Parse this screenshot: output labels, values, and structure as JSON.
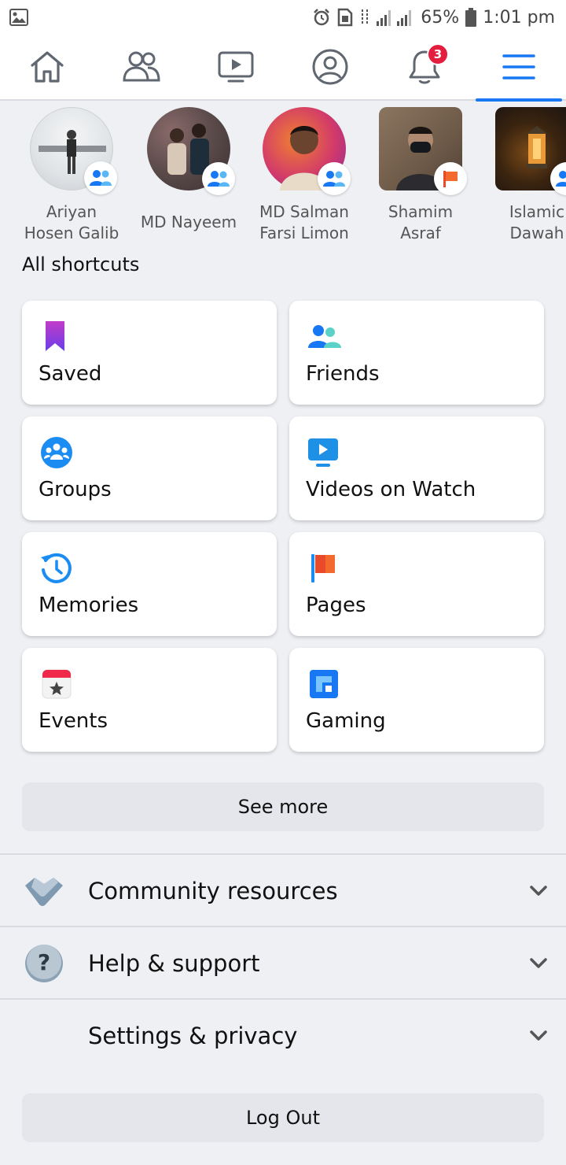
{
  "status_bar": {
    "battery": "65%",
    "time": "1:01 pm"
  },
  "nav": {
    "tabs": [
      {
        "name": "home",
        "icon": "home-icon"
      },
      {
        "name": "friends",
        "icon": "friends-icon"
      },
      {
        "name": "watch",
        "icon": "video-icon"
      },
      {
        "name": "profile",
        "icon": "profile-icon"
      },
      {
        "name": "notifications",
        "icon": "bell-icon",
        "badge": "3"
      },
      {
        "name": "menu",
        "icon": "hamburger-icon",
        "active": true
      }
    ]
  },
  "profiles": [
    {
      "name_line1": "Ariyan",
      "name_line2": "Hosen Galib",
      "badge": "group-icon"
    },
    {
      "name_line1": "MD Nayeem",
      "name_line2": "",
      "badge": "group-icon"
    },
    {
      "name_line1": "MD Salman",
      "name_line2": "Farsi Limon",
      "badge": "group-icon"
    },
    {
      "name_line1": "Shamim",
      "name_line2": "Asraf",
      "badge": "flag-icon"
    },
    {
      "name_line1": "Islamic",
      "name_line2": "Dawah",
      "badge": "group-icon"
    }
  ],
  "shortcuts_title": "All shortcuts",
  "shortcuts": [
    {
      "label": "Saved",
      "icon": "bookmark-icon"
    },
    {
      "label": "Friends",
      "icon": "friends-icon"
    },
    {
      "label": "Groups",
      "icon": "groups-icon"
    },
    {
      "label": "Videos on Watch",
      "icon": "video-icon"
    },
    {
      "label": "Memories",
      "icon": "clock-icon"
    },
    {
      "label": "Pages",
      "icon": "flag-icon"
    },
    {
      "label": "Events",
      "icon": "calendar-icon"
    },
    {
      "label": "Gaming",
      "icon": "gaming-icon"
    }
  ],
  "see_more": "See more",
  "sections": [
    {
      "label": "Community resources",
      "icon": "handshake-icon"
    },
    {
      "label": "Help & support",
      "icon": "question-icon"
    },
    {
      "label": "Settings & privacy",
      "icon": ""
    }
  ],
  "logout": "Log Out",
  "colors": {
    "accent": "#1877f2",
    "badge_red": "#e41e3f",
    "background": "#eef0f4"
  }
}
